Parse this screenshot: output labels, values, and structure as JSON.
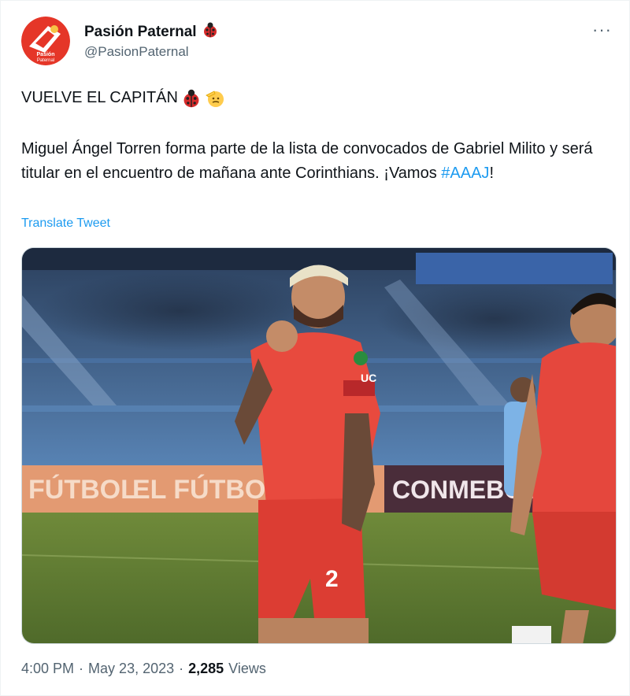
{
  "author": {
    "display_name": "Pasión Paternal",
    "handle": "@PasionPaternal",
    "avatar_text": "Pasión Paternal",
    "badge_icon": "ladybug-icon"
  },
  "tweet": {
    "line1": "VUELVE EL CAPITÁN",
    "line1_emojis": [
      "ladybug-icon",
      "saluting-face-icon"
    ],
    "body": "Miguel Ángel Torren forma parte de la lista de convocados de Gabriel Milito y será titular en el encuentro de mañana ante Corinthians. ¡Vamos ",
    "hashtag": "#AAAJ",
    "body_end": "!",
    "translate_label": "Translate Tweet"
  },
  "media": {
    "banner_left": "FÚTBOL",
    "banner_mid": "EL FÚTBOL ES FE",
    "banner_right": "CONMEBOL",
    "shirt_number": "2",
    "sponsor": "UC"
  },
  "meta": {
    "time": "4:00 PM",
    "separator1": "·",
    "date": "May 23, 2023",
    "separator2": "·",
    "views_count": "2,285",
    "views_label": "Views"
  },
  "colors": {
    "accent": "#1d9bf0",
    "secondary_text": "#536471",
    "jersey_red": "#e8473c"
  }
}
